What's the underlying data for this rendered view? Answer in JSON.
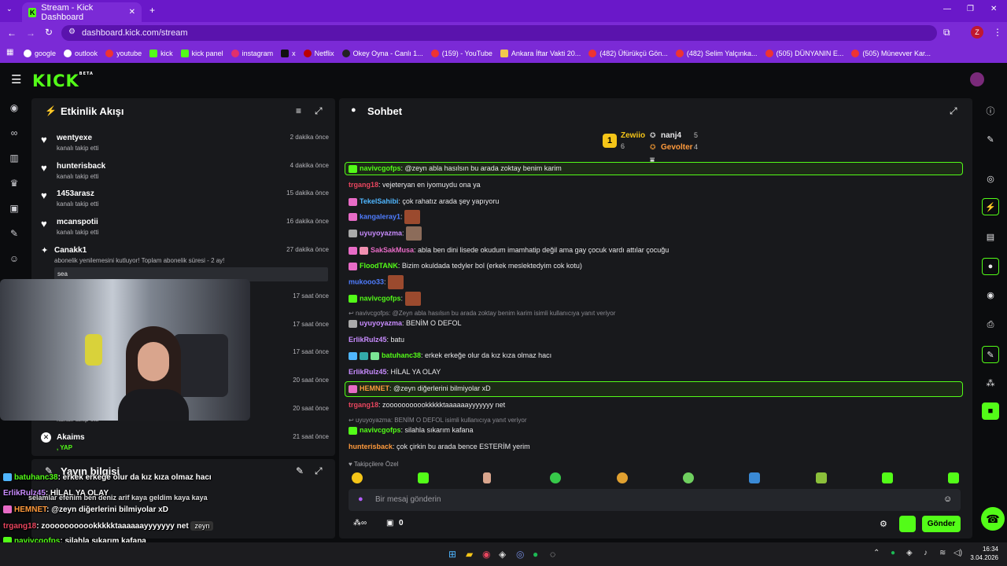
{
  "browser": {
    "tab_title": "Stream - Kick Dashboard",
    "url": "dashboard.kick.com/stream",
    "bookmarks": [
      "google",
      "outlook",
      "youtube",
      "kick",
      "kick panel",
      "instagram",
      "x",
      "Netflix",
      "Okey Oyna - Canlı 1...",
      "(159) - YouTube",
      "Ankara İftar Vakti 20...",
      "(482) Üfürükçü Gön...",
      "(482) Selim Yalçınka...",
      "(505) DÜNYANIN E...",
      "(505) Münevver Kar..."
    ],
    "avatar_letter": "Z"
  },
  "kick": {
    "logo": "KICK",
    "beta": "BETA"
  },
  "activity": {
    "title": "Etkinlik Akışı",
    "items": [
      {
        "name": "wentyexe",
        "sub": "kanalı takip etti",
        "time": "2 dakika önce"
      },
      {
        "name": "hunterisback",
        "sub": "kanalı takip etti",
        "time": "4 dakika önce"
      },
      {
        "name": "1453arasz",
        "sub": "kanalı takip etti",
        "time": "15 dakika önce"
      },
      {
        "name": "mcanspotii",
        "sub": "kanalı takip etti",
        "time": "16 dakika önce"
      },
      {
        "name": "Canakk1",
        "sub": "abonelik yenilemesini kutluyor! Toplam abonelik süresi - 2 ay!",
        "time": "27 dakika önce",
        "message": "sea"
      },
      {
        "name": "",
        "sub": "",
        "time": "17 saat önce"
      },
      {
        "name": "",
        "sub": "",
        "time": "17 saat önce"
      },
      {
        "name": "",
        "sub": "",
        "time": "17 saat önce"
      },
      {
        "name": "",
        "sub": "",
        "time": "20 saat önce"
      },
      {
        "name": "",
        "sub": "kanalı takip etti",
        "time": "20 saat önce"
      },
      {
        "name": "Akaims",
        "sub": ", YAP",
        "time": "21 saat önce"
      }
    ]
  },
  "stream_info": {
    "title": "Yayın bilgisi"
  },
  "chat": {
    "title": "Sohbet",
    "leaderboard": {
      "first": {
        "rank": "1",
        "name": "Zewiio",
        "count": "6"
      },
      "second": {
        "name": "nanj4",
        "count": "5"
      },
      "third": {
        "name": "Gevolter",
        "count": "4"
      }
    },
    "messages": [
      {
        "user": "navivcgofps",
        "text": ": @zeyn abla hasılsın bu arada zoktay benim karim",
        "color": "#53fc18"
      },
      {
        "user": "trgang18",
        "text": ": vejeteryan en iyomuydu ona ya",
        "color": "#e8455e"
      },
      {
        "user": "TekelSahibi",
        "text": ": çok rahatız arada şey yapıyoru",
        "color": "#4fb6ff"
      },
      {
        "user": "kangaleray1",
        "text": ":",
        "color": "#4f7dff"
      },
      {
        "user": "uyuyoyazma",
        "text": ":",
        "color": "#c98cff"
      },
      {
        "user": "SakSakMusa",
        "text": ": abla ben dini lisede okudum imamhatip değil ama gay çocuk vardı attılar çocuğu",
        "color": "#e86bc6"
      },
      {
        "user": "FloodTANK",
        "text": ": Bizim okuldada tedyler bol (erkek meslektedyim cok kotu)",
        "color": "#53fc18"
      },
      {
        "user": "mukooo33",
        "text": ":",
        "color": "#4f7dff"
      },
      {
        "user": "navivcgofps",
        "text": ":",
        "color": "#53fc18"
      },
      {
        "user": "uyuyoyazma",
        "text": ": BENİM O DEFOL",
        "color": "#c98cff",
        "reply": "navivcgofps: @Zeyn abla hasılsın bu arada zoktay benim karim isimli kullanıcıya yanıt veriyor"
      },
      {
        "user": "ErlikRulz45",
        "text": ": batu",
        "color": "#c98cff"
      },
      {
        "user": "batuhanc38",
        "text": ": erkek erkeğe olur da kız kıza olmaz hacı",
        "color": "#53fc18"
      },
      {
        "user": "ErlikRulz45",
        "text": ": HİLAL YA OLAY",
        "color": "#c98cff"
      },
      {
        "user": "HEMNET",
        "text": ": @zeyn diğerlerini bilmiyolar xD",
        "color": "#ff9a3c"
      },
      {
        "user": "trgang18",
        "text": ": zooooooooookkkkktaaaaaayyyyyyy net",
        "color": "#e8455e"
      },
      {
        "user": "navivcgofps",
        "text": ": silahla sıkarım kafana",
        "color": "#53fc18",
        "reply": "uyuyoyazma: BENİM O DEFOL isimli kullanıcıya yanıt veriyor"
      },
      {
        "user": "hunterisback",
        "text": ": çok çirkin bu arada bence ESTERİM yerim",
        "color": "#ff9a3c"
      }
    ],
    "followers_only": "Takipçilere Özel",
    "input_placeholder": "Bir mesaj gönderin",
    "send_label": "Gönder",
    "count": "0"
  },
  "overlay_chat": [
    {
      "user": "batuhanc38",
      "text": ": erkek erkeğe olur da kız kıza olmaz hacı",
      "color": "#53fc18"
    },
    {
      "user": "ErlikRulz45",
      "text": ": HİLAL YA OLAY",
      "color": "#c98cff"
    },
    {
      "user": "",
      "text": "selamlar efenim ben deniz arif kaya geldim kaya kaya",
      "color": "#fff"
    },
    {
      "user": "HEMNET",
      "text": ": @zeyn diğerlerini bilmiyolar xD",
      "color": "#ff9a3c"
    },
    {
      "user": "trgang18",
      "text": ": zooooooooookkkkktaaaaaayyyyyyy net",
      "color": "#e8455e"
    },
    {
      "user": "navivcgofps",
      "text": ": silahla sıkarım kafana",
      "color": "#53fc18"
    },
    {
      "user": "hunterisback",
      "text": ": çok çirkin bu arada bence ESTERİM yerim",
      "color": "#ff9a3c"
    }
  ],
  "overlay_tag": "zeyn",
  "taskbar": {
    "time": "16:34",
    "date": "3.04.2026"
  },
  "colors": {
    "accent": "#53fc18",
    "browser": "#7b2ad6"
  }
}
